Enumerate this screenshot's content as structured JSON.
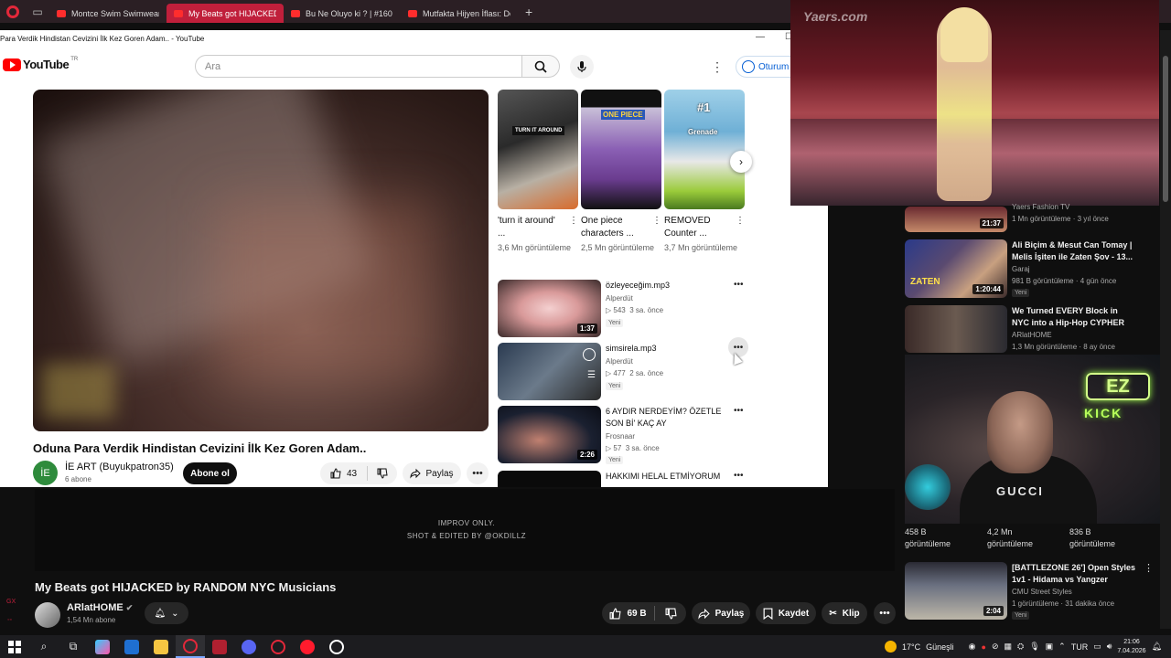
{
  "browser": {
    "tabs": [
      {
        "label": "Montce Swim Swimwear F",
        "active": false
      },
      {
        "label": "My Beats got HIJACKED b",
        "active": true
      },
      {
        "label": "Bu Ne Oluyo ki ? | #160 - You",
        "active": false
      },
      {
        "label": "Mutfakta Hijyen İflası: Defa",
        "active": false
      }
    ]
  },
  "inner_window": {
    "title": "Para Verdik Hindistan Cevizini İlk Kez Goren Adam.. - YouTube",
    "logo_text": "YouTube",
    "logo_country": "TR",
    "search_placeholder": "Ara",
    "signin_label": "Oturum a",
    "video": {
      "title": "Oduna Para Verdik Hindistan Cevizini İlk Kez Goren Adam..",
      "channel_initials": "İE",
      "channel": "İE ART (Buyukpatron35)",
      "subscribers": "6 abone",
      "subscribe_label": "Abone ol",
      "likes": "43",
      "share_label": "Paylaş"
    },
    "shorts": [
      {
        "title": "'turn it around' ...",
        "views": "3,6 Mn görüntüleme",
        "badge": "TURN IT AROUND"
      },
      {
        "title": "One piece characters ...",
        "views": "2,5 Mn görüntüleme",
        "badge": "ONE PIECE"
      },
      {
        "title": "REMOVED Counter ...",
        "views": "3,7 Mn görüntüleme",
        "badge": "#1",
        "badge2": "Grenade"
      }
    ],
    "recommendations": [
      {
        "title": "özleyeceğim.mp3",
        "channel": "Alperdüt",
        "views": "543",
        "age": "3 sa. önce",
        "badge": "Yeni",
        "duration": "1:37"
      },
      {
        "title": "simsirela.mp3",
        "channel": "Alperdüt",
        "views": "477",
        "age": "2 sa. önce",
        "badge": "Yeni",
        "duration": ""
      },
      {
        "title": "6 AYDIR NERDEYİM? ÖZETLE SON Bİ' KAÇ AY",
        "channel": "Frosnaar",
        "views": "57",
        "age": "3 sa. önce",
        "badge": "Yeni",
        "duration": "2:26"
      },
      {
        "title": "HAKKIMI HELAL ETMİYORUM",
        "channel": "",
        "views": "",
        "age": "",
        "badge": "",
        "duration": ""
      }
    ]
  },
  "outer_page": {
    "overlay_line1": "IMPROV ONLY.",
    "overlay_line2": "SHOT & EDITED BY @OKDILLZ",
    "video_title": "My Beats got HIJACKED by RANDOM NYC Musicians",
    "channel": "ARlatHOME",
    "subscribers": "1,54 Mn abone",
    "likes": "69 B",
    "share_label": "Paylaş",
    "save_label": "Kaydet",
    "clip_label": "Klip"
  },
  "sidebar": {
    "runway_watermark": "Yaers.com",
    "items": [
      {
        "title": "",
        "channel": "Yaers Fashion TV",
        "meta": "1 Mn görüntüleme · 3 yıl önce",
        "duration": "21:37",
        "badge": ""
      },
      {
        "title": "Ali Biçim & Mesut Can Tomay | Melis İşiten ile Zaten Şov - 13...",
        "channel": "Garaj",
        "meta": "981 B görüntüleme · 4 gün önce",
        "duration": "1:20:44",
        "badge": "Yeni"
      },
      {
        "title": "We Turned EVERY Block in NYC into a Hip-Hop CYPHER",
        "channel": "ARlatHOME",
        "meta": "1,3 Mn görüntüleme · 8 ay önce",
        "duration": "",
        "badge": ""
      },
      {
        "title": "[BATTLEZONE 26'] Open Styles 1v1 - Hidama vs Yangzer",
        "channel": "CMU Street Styles",
        "meta": "1 görüntüleme · 31 dakika önce",
        "duration": "2:04",
        "badge": "Yeni"
      }
    ],
    "webcam_neon_top": "EZ",
    "webcam_neon_bottom": "KICK",
    "shirt_text": "GUCCI",
    "stats": [
      {
        "value": "458 B",
        "label": "görüntüleme"
      },
      {
        "value": "4,2 Mn",
        "label": "görüntüleme"
      },
      {
        "value": "836 B",
        "label": "görüntüleme"
      }
    ]
  },
  "taskbar": {
    "weather": "17°C",
    "weather_label": "Güneşli",
    "lang": "TUR",
    "time": "21:06",
    "date": "7.04.2026"
  },
  "colors": {
    "yt_red": "#ff0000",
    "opera_red": "#c01f3b",
    "link_blue": "#065fd4",
    "neon_green": "#b8ff5a"
  }
}
